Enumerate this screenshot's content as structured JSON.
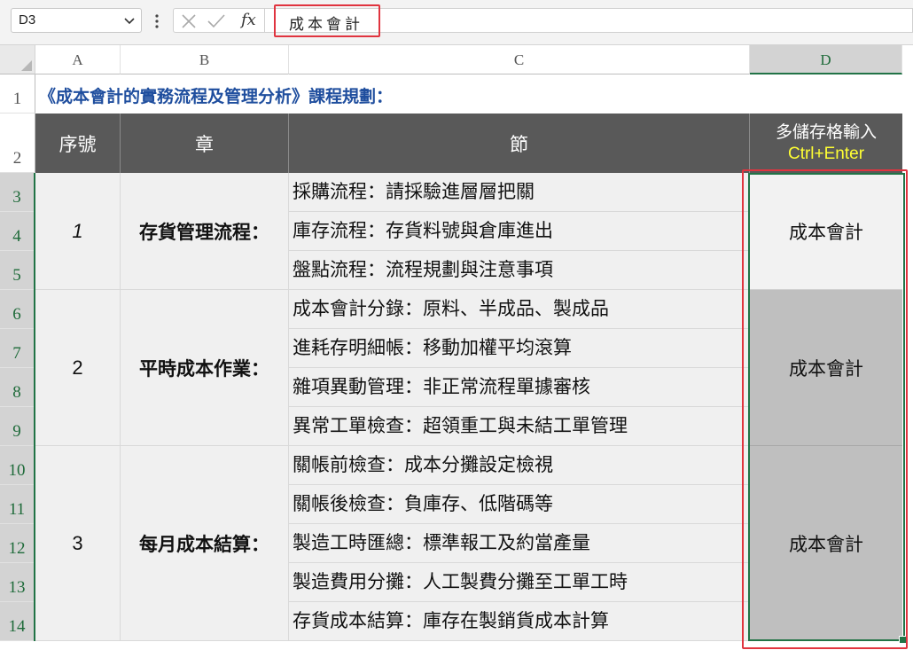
{
  "formula_bar": {
    "name_box": "D3",
    "fx_label": "fx",
    "formula": "成本會計",
    "icons": [
      "chevron-down-icon",
      "more-vertical-icon",
      "cancel-x-icon",
      "confirm-check-icon",
      "fx-icon"
    ]
  },
  "columns": [
    {
      "label": "A",
      "selected": false
    },
    {
      "label": "B",
      "selected": false
    },
    {
      "label": "C",
      "selected": false
    },
    {
      "label": "D",
      "selected": true
    }
  ],
  "rows": [
    "1",
    "2",
    "3",
    "4",
    "5",
    "6",
    "7",
    "8",
    "9",
    "10",
    "11",
    "12",
    "13",
    "14"
  ],
  "sheet": {
    "title": "《成本會計的實務流程及管理分析》課程規劃：",
    "headers": {
      "seq": "序號",
      "chapter": "章",
      "section": "節",
      "d_line1": "多儲存格輸入",
      "d_line2": "Ctrl+Enter"
    },
    "groups": [
      {
        "seq": "1",
        "chapter": "存貨管理流程：",
        "sections": [
          "採購流程：請採驗進層層把關",
          "庫存流程：存貨料號與倉庫進出",
          "盤點流程：流程規劃與注意事項"
        ],
        "d_value": "成本會計"
      },
      {
        "seq": "2",
        "chapter": "平時成本作業：",
        "sections": [
          "成本會計分錄：原料、半成品、製成品",
          "進耗存明細帳：移動加權平均滾算",
          "雜項異動管理：非正常流程單據審核",
          "異常工單檢查：超領重工與未結工單管理"
        ],
        "d_value": "成本會計"
      },
      {
        "seq": "3",
        "chapter": "每月成本結算：",
        "sections": [
          "關帳前檢查：成本分攤設定檢視",
          "關帳後檢查：負庫存、低階碼等",
          "製造工時匯總：標準報工及約當產量",
          "製造費用分攤：人工製費分攤至工單工時",
          "存貨成本結算：庫存在製銷貨成本計算"
        ],
        "d_value": "成本會計"
      }
    ]
  },
  "colors": {
    "header_bg": "#595959",
    "header_text": "#ffffff",
    "shortcut_text": "#ffff33",
    "title_text": "#1f4e9e",
    "cell_bg": "#f0f0f0",
    "selected_fill": "#bfbfbf",
    "selection_border": "#217346",
    "highlight_red": "#e0343f"
  }
}
